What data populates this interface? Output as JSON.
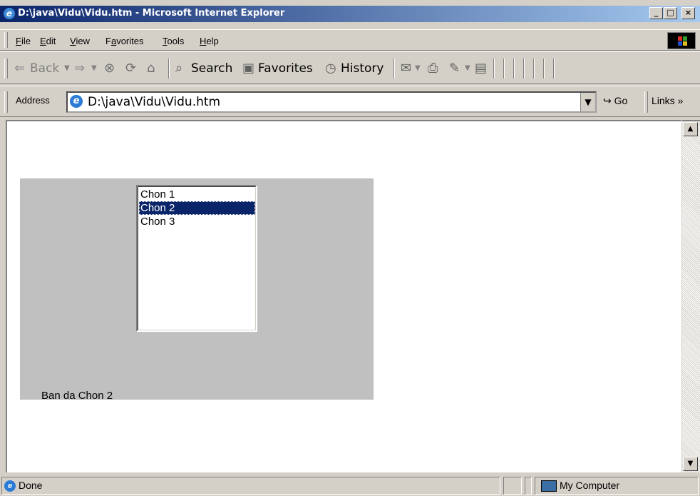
{
  "window": {
    "title": "D:\\java\\Vidu\\Vidu.htm - Microsoft Internet Explorer",
    "min_symbol": "_",
    "max_symbol": "□",
    "close_symbol": "×"
  },
  "menu": {
    "items": [
      {
        "label_pre": "",
        "label_ul": "F",
        "label_post": "ile"
      },
      {
        "label_pre": "",
        "label_ul": "E",
        "label_post": "dit"
      },
      {
        "label_pre": "",
        "label_ul": "V",
        "label_post": "iew"
      },
      {
        "label_pre": "F",
        "label_ul": "a",
        "label_post": "vorites"
      },
      {
        "label_pre": "",
        "label_ul": "T",
        "label_post": "ools"
      },
      {
        "label_pre": "",
        "label_ul": "H",
        "label_post": "elp"
      }
    ]
  },
  "toolbar": {
    "back_label": "Back",
    "search_label": "Search",
    "favorites_label": "Favorites",
    "history_label": "History"
  },
  "address": {
    "label": "Address",
    "url": "D:\\java\\Vidu\\Vidu.htm",
    "go_label": "Go",
    "links_label": "Links"
  },
  "applet": {
    "options": [
      "Chon 1",
      "Chon 2",
      "Chon 3"
    ],
    "selected_index": 1,
    "result_text": "Ban da Chon 2",
    "bg_color": "#c0c0c0",
    "selection_color": "#0a246a"
  },
  "status": {
    "text": "Done",
    "zone_label": "My Computer"
  }
}
